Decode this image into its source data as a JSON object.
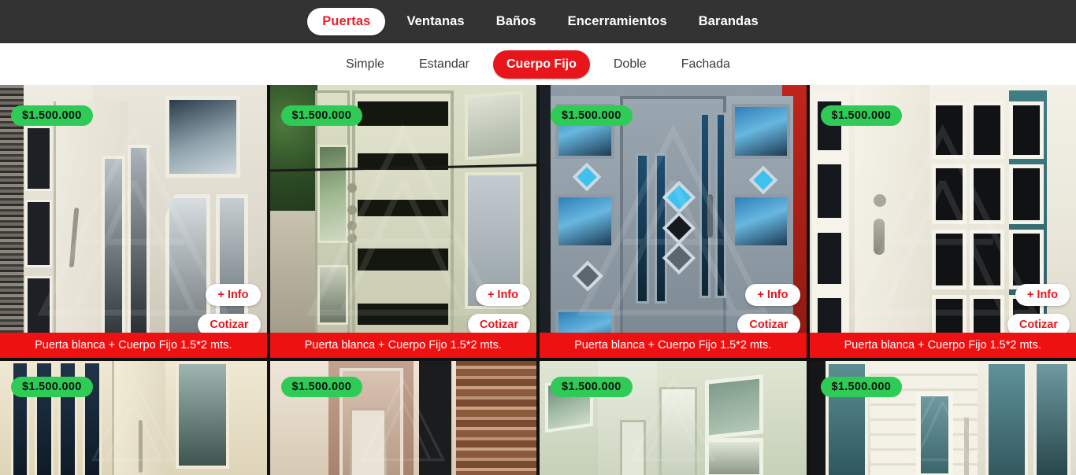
{
  "topnav": {
    "items": [
      {
        "label": "Puertas",
        "active": true
      },
      {
        "label": "Ventanas",
        "active": false
      },
      {
        "label": "Baños",
        "active": false
      },
      {
        "label": "Encerramientos",
        "active": false
      },
      {
        "label": "Barandas",
        "active": false
      }
    ]
  },
  "subnav": {
    "items": [
      {
        "label": "Simple",
        "active": false
      },
      {
        "label": "Estandar",
        "active": false
      },
      {
        "label": "Cuerpo Fijo",
        "active": true
      },
      {
        "label": "Doble",
        "active": false
      },
      {
        "label": "Fachada",
        "active": false
      }
    ]
  },
  "labels": {
    "info": "+ Info",
    "cotizar": "Cotizar"
  },
  "colors": {
    "nav_background": "#333333",
    "accent_red": "#e8161b",
    "caption_red": "#ee1111",
    "price_green": "#2ecc57",
    "active_pill_text": "#e8202a"
  },
  "products": [
    {
      "price": "$1.500.000",
      "caption": "Puerta blanca + Cuerpo Fijo 1.5*2 mts.",
      "info": "+ Info",
      "cotizar": "Cotizar"
    },
    {
      "price": "$1.500.000",
      "caption": "Puerta blanca + Cuerpo Fijo 1.5*2 mts.",
      "info": "+ Info",
      "cotizar": "Cotizar"
    },
    {
      "price": "$1.500.000",
      "caption": "Puerta blanca + Cuerpo Fijo 1.5*2 mts.",
      "info": "+ Info",
      "cotizar": "Cotizar"
    },
    {
      "price": "$1.500.000",
      "caption": "Puerta blanca + Cuerpo Fijo 1.5*2 mts.",
      "info": "+ Info",
      "cotizar": "Cotizar"
    },
    {
      "price": "$1.500.000"
    },
    {
      "price": "$1.500.000"
    },
    {
      "price": "$1.500.000"
    },
    {
      "price": "$1.500.000"
    }
  ]
}
